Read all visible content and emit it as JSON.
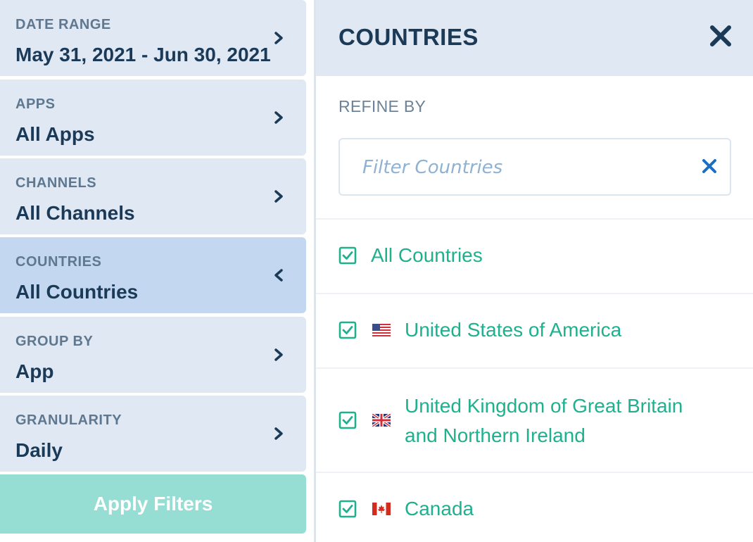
{
  "filters": [
    {
      "label": "DATE RANGE",
      "value": "May 31, 2021 - Jun 30, 2021",
      "active": false
    },
    {
      "label": "APPS",
      "value": "All Apps",
      "active": false
    },
    {
      "label": "CHANNELS",
      "value": "All Channels",
      "active": false
    },
    {
      "label": "COUNTRIES",
      "value": "All Countries",
      "active": true
    },
    {
      "label": "GROUP BY",
      "value": "App",
      "active": false
    },
    {
      "label": "GRANULARITY",
      "value": "Daily",
      "active": false
    }
  ],
  "apply_label": "Apply Filters",
  "panel": {
    "title": "COUNTRIES",
    "refine_label": "REFINE BY",
    "search_placeholder": "Filter Countries",
    "search_value": ""
  },
  "countries": [
    {
      "label": "All Countries",
      "checked": true,
      "flag": null
    },
    {
      "label": "United States of America",
      "checked": true,
      "flag": "us-flag-icon"
    },
    {
      "label": "United Kingdom of Great Britain and Northern Ireland",
      "label_line1": "United Kingdom of Great Britain",
      "label_line2": "and Northern Ireland",
      "checked": true,
      "flag": "uk-flag-icon"
    },
    {
      "label": "Canada",
      "checked": true,
      "flag": "canada-flag-icon"
    }
  ],
  "colors": {
    "accent_green": "#1fb08e",
    "navy": "#1b3a57",
    "panel_bg": "#dfe8f3",
    "active_bg": "#c3d8f0",
    "apply_bg": "#96ddd3",
    "close_blue": "#1b6fc2"
  }
}
